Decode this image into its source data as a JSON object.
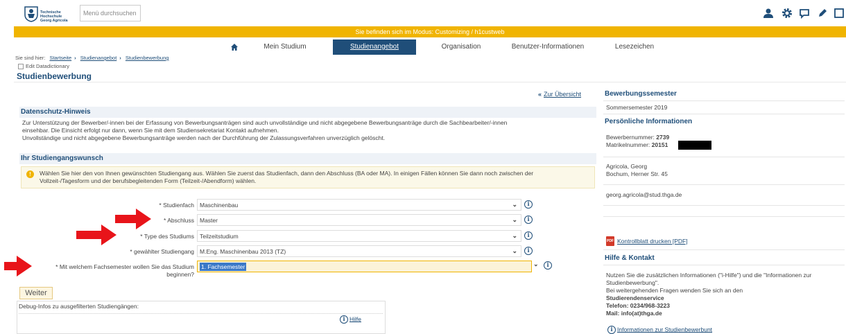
{
  "header": {
    "logo_text": "Technische\nHochschule\nGeorg Agricola",
    "search_placeholder": "Menü durchsuchen",
    "icons": [
      "user-icon",
      "gear-icon",
      "chat-icon",
      "pencil-icon",
      "window-icon"
    ]
  },
  "modebar": {
    "text": "Sie befinden sich im Modus: Customizing / h1custweb",
    "color": "#f0b400"
  },
  "nav": {
    "home_icon": "home-icon",
    "items": [
      {
        "label": "Mein Studium"
      },
      {
        "label": "Studienangebot"
      },
      {
        "label": "Organisation"
      },
      {
        "label": "Benutzer-Informationen"
      },
      {
        "label": "Lesezeichen"
      }
    ],
    "active_color": "#1f4e79"
  },
  "breadcrumb": {
    "prefix": "Sie sind hier:",
    "items": [
      "Startseite",
      "Studienangebot",
      "Studienbewerbung"
    ]
  },
  "edit_datadictionary": "Edit Datadictionary",
  "page_title": "Studienbewerbung",
  "back_link": "Zur Übersicht",
  "privacy": {
    "title": "Datenschutz-Hinweis",
    "line1": "Zur Unterstützung der Bewerber/-innen bei der Erfassung von Bewerbungsanträgen sind auch unvollständige und nicht abgegebene Bewerbungsanträge durch die Sachbearbeiter/-innen",
    "line2": "einsehbar. Die Einsicht erfolgt nur dann, wenn Sie mit dem Studiensekretariat Kontakt aufnehmen.",
    "line3": "Unvollständige und nicht abgegebene Bewerbungsanträge werden nach der Durchführung der Zulassungsverfahren unverzüglich gelöscht."
  },
  "wish": {
    "title": "Ihr Studiengangswunsch",
    "hint_line1": "Wählen Sie hier den von Ihnen gewünschten Studiengang aus. Wählen Sie zuerst das Studienfach, dann den Abschluss (BA oder MA). In einigen Fällen können Sie dann noch zwischen der",
    "hint_line2": "Vollzeit-/Tagesform und der berufsbegleitenden Form (Teilzeit-/Abendform) wählen."
  },
  "form": {
    "studienfach": {
      "label": "* Studienfach",
      "value": "Maschinenbau"
    },
    "abschluss": {
      "label": "* Abschluss",
      "value": "Master"
    },
    "typ": {
      "label": "* Type des Studiums",
      "value": "Teilzeitstudium"
    },
    "studiengang": {
      "label": "* gewählter Studiengang",
      "value": "M.Eng. Maschinenbau 2013 (TZ)"
    },
    "fachsemester": {
      "label_line1": "* Mit welchem Fachsemester wollen Sie das Studium",
      "label_line2": "beginnen?",
      "value": "1. Fachsemester"
    }
  },
  "weiter_label": "Weiter",
  "debug": {
    "text": "Debug-Infos zu ausgefilterten Studiengängen:",
    "help_label": "Hilfe"
  },
  "right": {
    "semester_title": "Bewerbungssemester",
    "semester_value": "Sommersemester 2019",
    "personal_title": "Persönliche Informationen",
    "bewerbernummer_label": "Bewerbernummer:",
    "bewerbernummer_value": "2739",
    "matrikel_label": "Matrikelnummer:",
    "matrikel_value": "20151",
    "name": "Agricola, Georg",
    "address": "Bochum, Herner Str. 45",
    "email": "georg.agricola@stud.thga.de",
    "kontrollblatt": "Kontrollblatt drucken [PDF]",
    "help_title": "Hilfe & Kontakt",
    "help_line1": "Nutzen Sie die zusätzlichen Informationen (\"i-Hilfe\") und die \"Informationen zur",
    "help_line2": "Studienbewerbung\".",
    "help_line3": "Bei weitergehenden Fragen wenden Sie sich an den",
    "service_name": "Studierendenservice",
    "phone": "Telefon: 0234/968-3223",
    "mail": "Mail: info(at)thga.de",
    "info_link": "Informationen zur Studienbewerbunt"
  }
}
